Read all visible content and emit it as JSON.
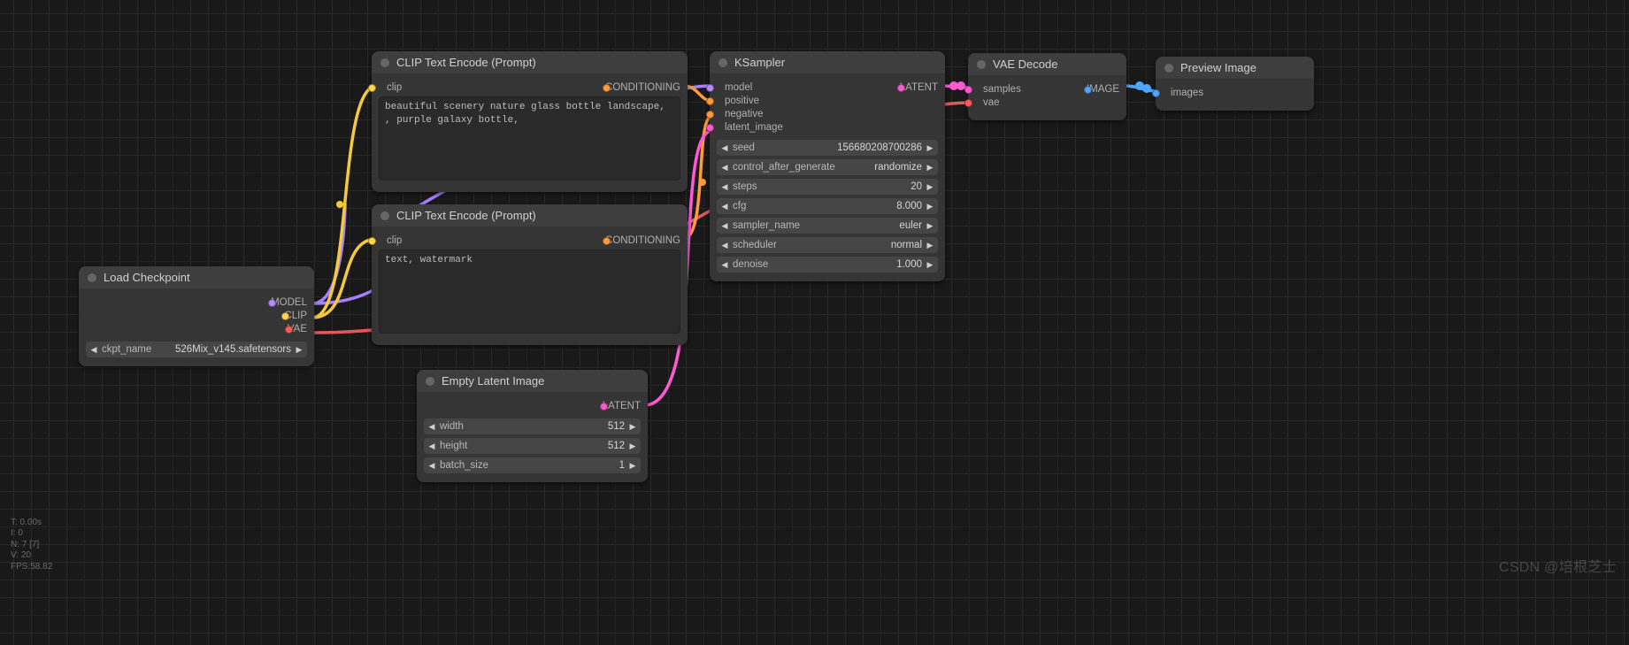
{
  "stats": {
    "t": "T: 0.00s",
    "i": "I: 0",
    "n": "N: 7 [7]",
    "v": "V: 20",
    "fps": "FPS:58.82"
  },
  "watermark": "CSDN @培根芝士",
  "nodes": {
    "load_checkpoint": {
      "title": "Load Checkpoint",
      "outputs": {
        "model": "MODEL",
        "clip": "CLIP",
        "vae": "VAE"
      },
      "widgets": {
        "ckpt_name": {
          "label": "ckpt_name",
          "value": "526Mix_v145.safetensors"
        }
      }
    },
    "clip_pos": {
      "title": "CLIP Text Encode (Prompt)",
      "inputs": {
        "clip": "clip"
      },
      "outputs": {
        "conditioning": "CONDITIONING"
      },
      "text": "beautiful scenery nature glass bottle landscape, , purple galaxy bottle,"
    },
    "clip_neg": {
      "title": "CLIP Text Encode (Prompt)",
      "inputs": {
        "clip": "clip"
      },
      "outputs": {
        "conditioning": "CONDITIONING"
      },
      "text": "text, watermark"
    },
    "empty_latent": {
      "title": "Empty Latent Image",
      "outputs": {
        "latent": "LATENT"
      },
      "widgets": {
        "width": {
          "label": "width",
          "value": "512"
        },
        "height": {
          "label": "height",
          "value": "512"
        },
        "batch": {
          "label": "batch_size",
          "value": "1"
        }
      }
    },
    "ksampler": {
      "title": "KSampler",
      "inputs": {
        "model": "model",
        "positive": "positive",
        "negative": "negative",
        "latent_image": "latent_image"
      },
      "outputs": {
        "latent": "LATENT"
      },
      "widgets": {
        "seed": {
          "label": "seed",
          "value": "156680208700286"
        },
        "ctrl": {
          "label": "control_after_generate",
          "value": "randomize"
        },
        "steps": {
          "label": "steps",
          "value": "20"
        },
        "cfg": {
          "label": "cfg",
          "value": "8.000"
        },
        "sampler": {
          "label": "sampler_name",
          "value": "euler"
        },
        "scheduler": {
          "label": "scheduler",
          "value": "normal"
        },
        "denoise": {
          "label": "denoise",
          "value": "1.000"
        }
      }
    },
    "vae_decode": {
      "title": "VAE Decode",
      "inputs": {
        "samples": "samples",
        "vae": "vae"
      },
      "outputs": {
        "image": "IMAGE"
      }
    },
    "preview": {
      "title": "Preview Image",
      "inputs": {
        "images": "images"
      }
    }
  }
}
